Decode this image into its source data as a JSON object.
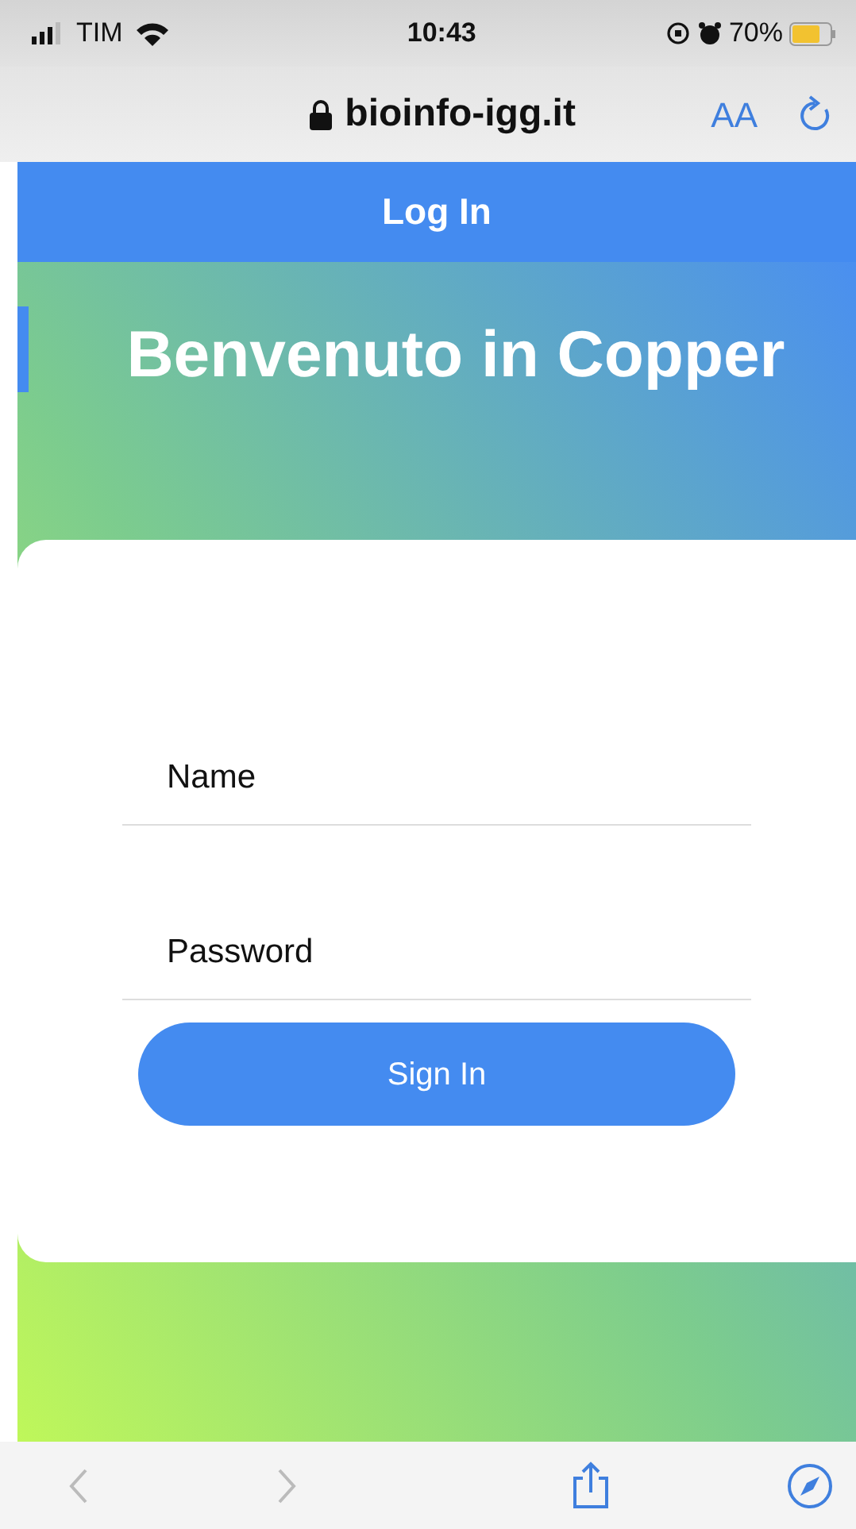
{
  "status_bar": {
    "carrier": "TIM",
    "time": "10:43",
    "battery": "70%"
  },
  "address_bar": {
    "url": "bioinfo-igg.it",
    "text_size": "AA"
  },
  "header": {
    "title": "Log In"
  },
  "hero": {
    "title": "Benvenuto in Copper"
  },
  "form": {
    "fields": [
      {
        "placeholder": "Name"
      },
      {
        "placeholder": "Password"
      }
    ],
    "submit": "Sign In"
  },
  "toolbar": [
    {
      "kind": "back",
      "disabled": true
    },
    {
      "kind": "forward",
      "disabled": true
    },
    {
      "kind": "share",
      "disabled": false
    },
    {
      "kind": "compass",
      "disabled": false
    }
  ]
}
